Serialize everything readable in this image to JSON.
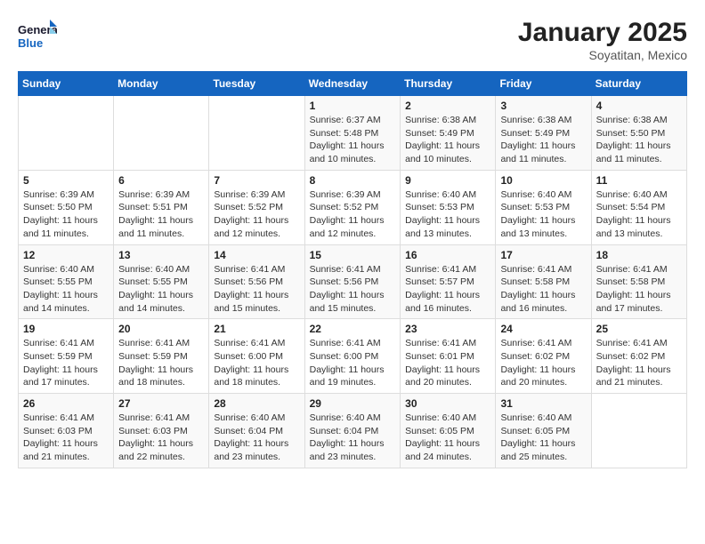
{
  "logo": {
    "line1": "General",
    "line2": "Blue"
  },
  "title": "January 2025",
  "location": "Soyatitan, Mexico",
  "weekdays": [
    "Sunday",
    "Monday",
    "Tuesday",
    "Wednesday",
    "Thursday",
    "Friday",
    "Saturday"
  ],
  "weeks": [
    [
      {
        "day": "",
        "info": ""
      },
      {
        "day": "",
        "info": ""
      },
      {
        "day": "",
        "info": ""
      },
      {
        "day": "1",
        "info": "Sunrise: 6:37 AM\nSunset: 5:48 PM\nDaylight: 11 hours\nand 10 minutes."
      },
      {
        "day": "2",
        "info": "Sunrise: 6:38 AM\nSunset: 5:49 PM\nDaylight: 11 hours\nand 10 minutes."
      },
      {
        "day": "3",
        "info": "Sunrise: 6:38 AM\nSunset: 5:49 PM\nDaylight: 11 hours\nand 11 minutes."
      },
      {
        "day": "4",
        "info": "Sunrise: 6:38 AM\nSunset: 5:50 PM\nDaylight: 11 hours\nand 11 minutes."
      }
    ],
    [
      {
        "day": "5",
        "info": "Sunrise: 6:39 AM\nSunset: 5:50 PM\nDaylight: 11 hours\nand 11 minutes."
      },
      {
        "day": "6",
        "info": "Sunrise: 6:39 AM\nSunset: 5:51 PM\nDaylight: 11 hours\nand 11 minutes."
      },
      {
        "day": "7",
        "info": "Sunrise: 6:39 AM\nSunset: 5:52 PM\nDaylight: 11 hours\nand 12 minutes."
      },
      {
        "day": "8",
        "info": "Sunrise: 6:39 AM\nSunset: 5:52 PM\nDaylight: 11 hours\nand 12 minutes."
      },
      {
        "day": "9",
        "info": "Sunrise: 6:40 AM\nSunset: 5:53 PM\nDaylight: 11 hours\nand 13 minutes."
      },
      {
        "day": "10",
        "info": "Sunrise: 6:40 AM\nSunset: 5:53 PM\nDaylight: 11 hours\nand 13 minutes."
      },
      {
        "day": "11",
        "info": "Sunrise: 6:40 AM\nSunset: 5:54 PM\nDaylight: 11 hours\nand 13 minutes."
      }
    ],
    [
      {
        "day": "12",
        "info": "Sunrise: 6:40 AM\nSunset: 5:55 PM\nDaylight: 11 hours\nand 14 minutes."
      },
      {
        "day": "13",
        "info": "Sunrise: 6:40 AM\nSunset: 5:55 PM\nDaylight: 11 hours\nand 14 minutes."
      },
      {
        "day": "14",
        "info": "Sunrise: 6:41 AM\nSunset: 5:56 PM\nDaylight: 11 hours\nand 15 minutes."
      },
      {
        "day": "15",
        "info": "Sunrise: 6:41 AM\nSunset: 5:56 PM\nDaylight: 11 hours\nand 15 minutes."
      },
      {
        "day": "16",
        "info": "Sunrise: 6:41 AM\nSunset: 5:57 PM\nDaylight: 11 hours\nand 16 minutes."
      },
      {
        "day": "17",
        "info": "Sunrise: 6:41 AM\nSunset: 5:58 PM\nDaylight: 11 hours\nand 16 minutes."
      },
      {
        "day": "18",
        "info": "Sunrise: 6:41 AM\nSunset: 5:58 PM\nDaylight: 11 hours\nand 17 minutes."
      }
    ],
    [
      {
        "day": "19",
        "info": "Sunrise: 6:41 AM\nSunset: 5:59 PM\nDaylight: 11 hours\nand 17 minutes."
      },
      {
        "day": "20",
        "info": "Sunrise: 6:41 AM\nSunset: 5:59 PM\nDaylight: 11 hours\nand 18 minutes."
      },
      {
        "day": "21",
        "info": "Sunrise: 6:41 AM\nSunset: 6:00 PM\nDaylight: 11 hours\nand 18 minutes."
      },
      {
        "day": "22",
        "info": "Sunrise: 6:41 AM\nSunset: 6:00 PM\nDaylight: 11 hours\nand 19 minutes."
      },
      {
        "day": "23",
        "info": "Sunrise: 6:41 AM\nSunset: 6:01 PM\nDaylight: 11 hours\nand 20 minutes."
      },
      {
        "day": "24",
        "info": "Sunrise: 6:41 AM\nSunset: 6:02 PM\nDaylight: 11 hours\nand 20 minutes."
      },
      {
        "day": "25",
        "info": "Sunrise: 6:41 AM\nSunset: 6:02 PM\nDaylight: 11 hours\nand 21 minutes."
      }
    ],
    [
      {
        "day": "26",
        "info": "Sunrise: 6:41 AM\nSunset: 6:03 PM\nDaylight: 11 hours\nand 21 minutes."
      },
      {
        "day": "27",
        "info": "Sunrise: 6:41 AM\nSunset: 6:03 PM\nDaylight: 11 hours\nand 22 minutes."
      },
      {
        "day": "28",
        "info": "Sunrise: 6:40 AM\nSunset: 6:04 PM\nDaylight: 11 hours\nand 23 minutes."
      },
      {
        "day": "29",
        "info": "Sunrise: 6:40 AM\nSunset: 6:04 PM\nDaylight: 11 hours\nand 23 minutes."
      },
      {
        "day": "30",
        "info": "Sunrise: 6:40 AM\nSunset: 6:05 PM\nDaylight: 11 hours\nand 24 minutes."
      },
      {
        "day": "31",
        "info": "Sunrise: 6:40 AM\nSunset: 6:05 PM\nDaylight: 11 hours\nand 25 minutes."
      },
      {
        "day": "",
        "info": ""
      }
    ]
  ]
}
